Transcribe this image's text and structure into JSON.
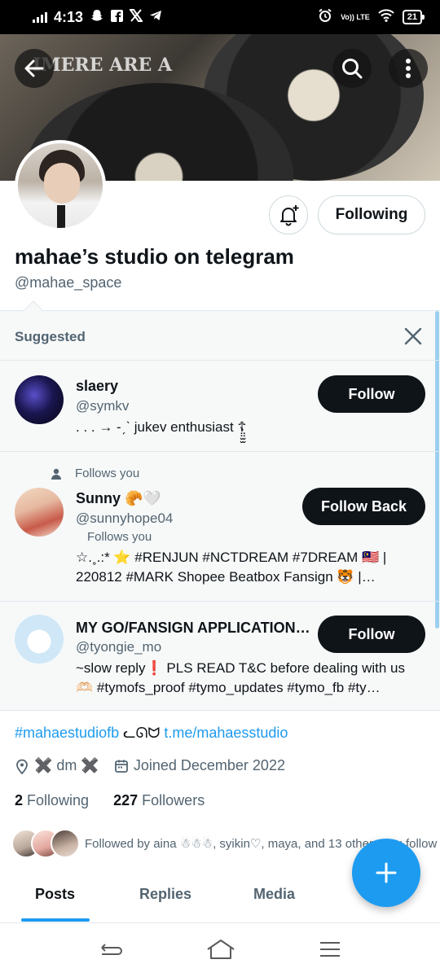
{
  "status_bar": {
    "time": "4:13",
    "network_label": "Vo)) LTE",
    "battery": "21",
    "left_icons": [
      "snapchat-icon",
      "facebook-icon",
      "x-icon",
      "telegram-icon"
    ],
    "right_icons": [
      "alarm-icon",
      "wifi-icon",
      "battery-icon"
    ]
  },
  "header": {
    "banner_text": "IMERE ARE A",
    "back_icon": "arrow-left-icon",
    "search_icon": "search-icon",
    "more_icon": "more-vertical-icon"
  },
  "profile": {
    "display_name": "mahae’s studio on telegram",
    "handle": "@mahae_space",
    "following_button": "Following",
    "bell_icon": "bell-plus-icon"
  },
  "suggested": {
    "title": "Suggested",
    "close_icon": "close-icon",
    "cards": [
      {
        "name": "slaery",
        "handle": "@symkv",
        "bio": ". . . → -ˏˋ jukev enthusiast ☦̤̤̫̫",
        "button": "Follow",
        "follows_you_top": "",
        "follows_you_inline": ""
      },
      {
        "name": "Sunny 🥐🤍",
        "handle": "@sunnyhope04",
        "bio": "☆.˳.:* ⭐ #RENJUN #NCTDREAM #7DREAM 🇲🇾 | 220812 #MARK Shopee Beatbox Fansign 🐯 | Bum…",
        "button": "Follow Back",
        "follows_you_top": "Follows you",
        "follows_you_inline": "Follows you"
      },
      {
        "name": "MY GO/FANSIGN APPLICATION…",
        "handle": "@tyongie_mo",
        "bio": "~slow reply❗ PLS READ T&C before dealing with us 🫶🏻 #tymofs_proof #tymo_updates #tymo_fb #ty…",
        "button": "Follow",
        "follows_you_top": "",
        "follows_you_inline": ""
      }
    ]
  },
  "bio": {
    "hashtag": "#mahaestudiofb",
    "separator": "ᓚᘏᗢ",
    "link": "t.me/mahaesstudio",
    "location": "✖️ dm ✖️",
    "joined": "Joined December 2022"
  },
  "counts": {
    "following_num": "2",
    "following_label": "Following",
    "followers_num": "227",
    "followers_label": "Followers"
  },
  "followed_by": "Followed by aina ☃︎☃︎☃︎, syikin♡, maya, and 13 others you follow",
  "tabs": [
    "Posts",
    "Replies",
    "Media"
  ],
  "colors": {
    "accent": "#1d9bf0",
    "primary_text": "#0f1419",
    "secondary_text": "#536471",
    "button_dark": "#0f1419",
    "suggested_bg": "#f7f9f9"
  },
  "navbar": [
    "back-nav-icon",
    "home-nav-icon",
    "recents-nav-icon"
  ]
}
